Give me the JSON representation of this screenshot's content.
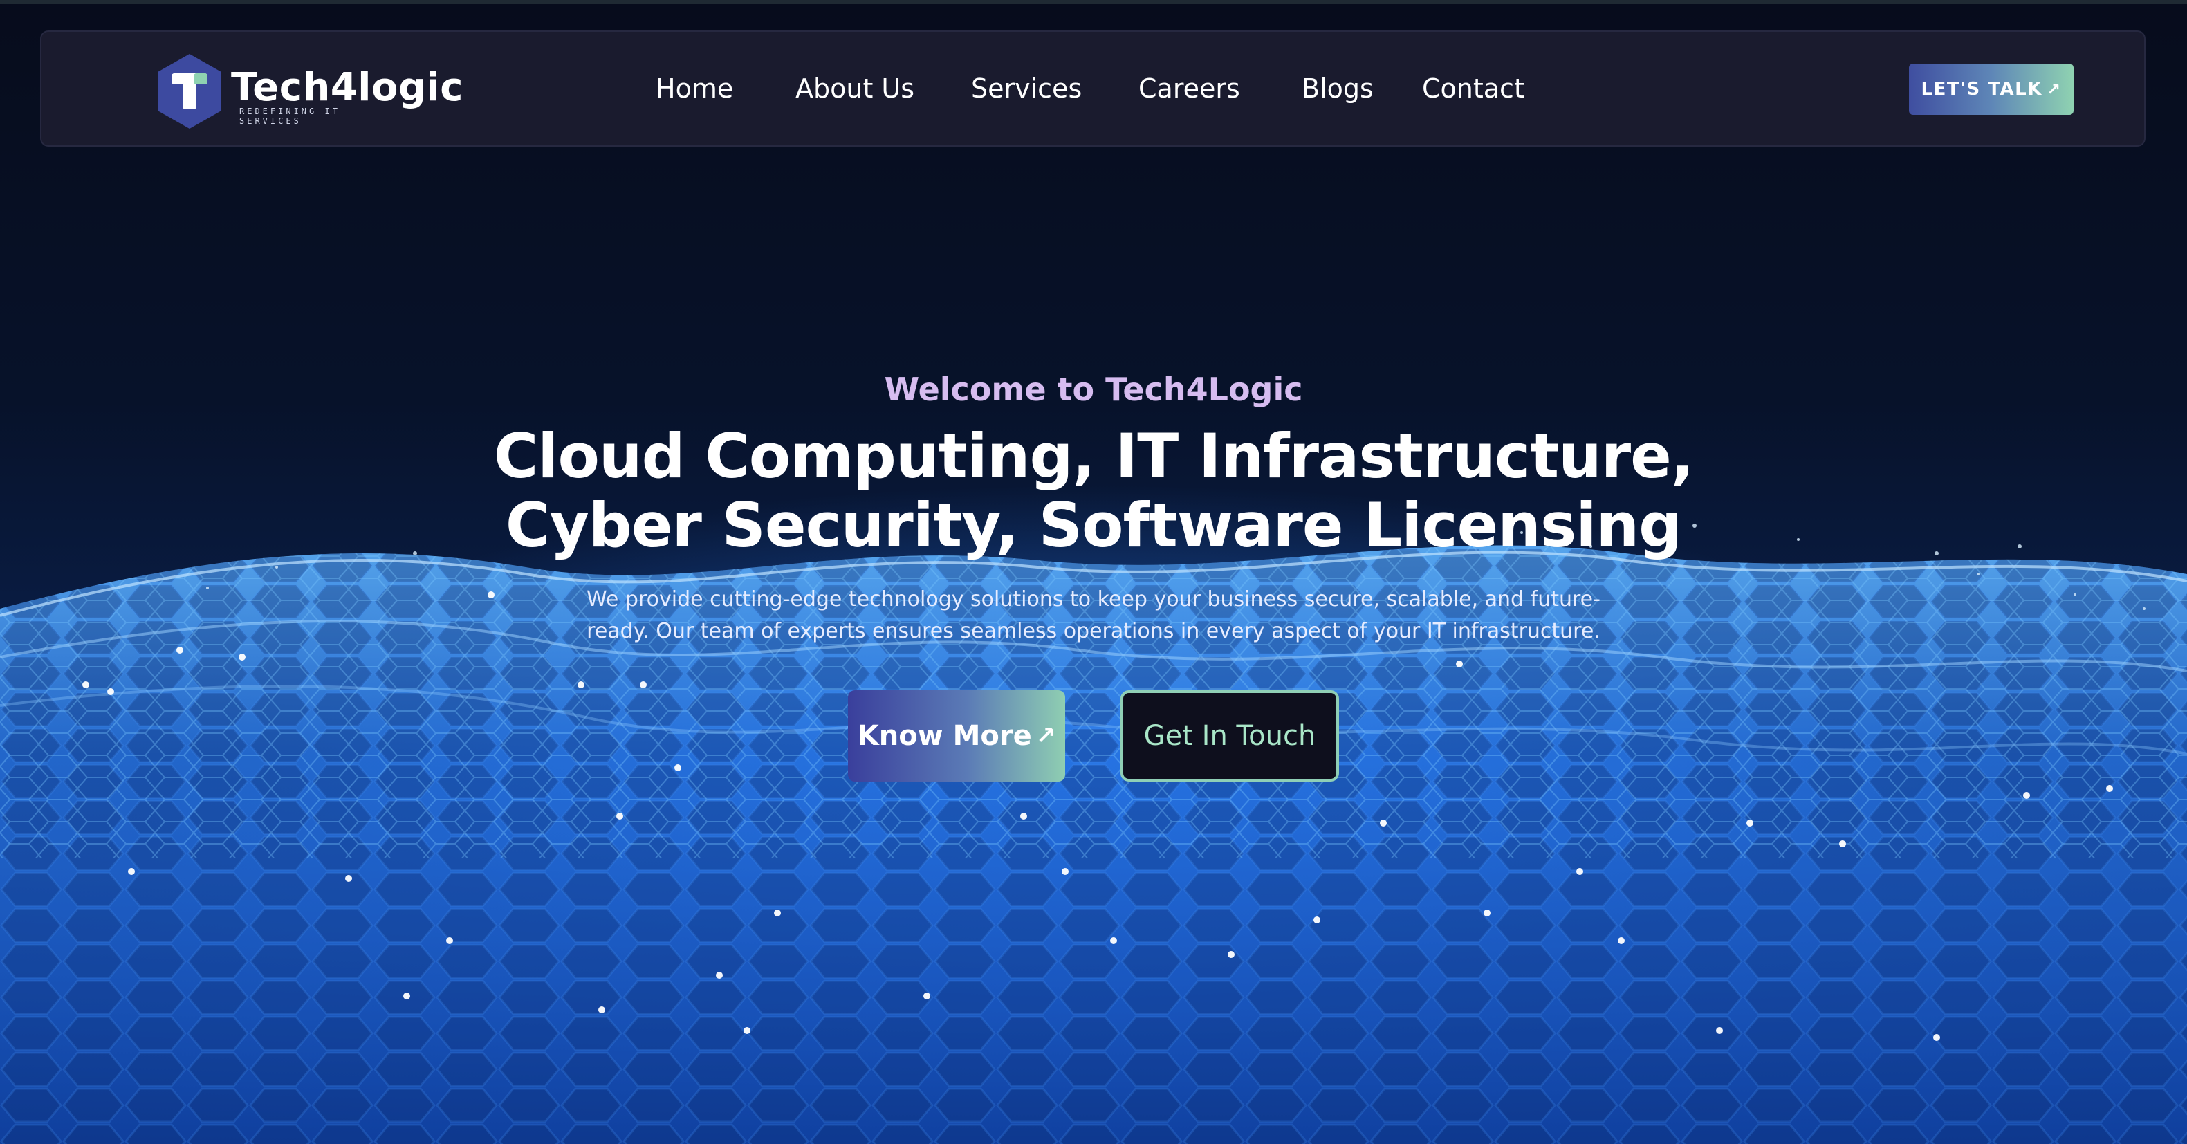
{
  "brand": {
    "name": "Tech4logic",
    "tagline": "REDEFINING IT SERVICES",
    "logo_letter": "T",
    "colors": {
      "hex_primary": "#3d4aa0",
      "hex_accent": "#8fd2b1",
      "nav_bg": "#1a1b2e"
    }
  },
  "nav": {
    "items": [
      {
        "label": "Home"
      },
      {
        "label": "About Us"
      },
      {
        "label": "Services"
      },
      {
        "label": "Careers"
      },
      {
        "label": "Blogs"
      },
      {
        "label": "Contact"
      }
    ],
    "cta_label": "LET'S TALK",
    "cta_icon": "arrow-up-right-icon"
  },
  "hero": {
    "eyebrow": "Welcome to Tech4Logic",
    "title_line1": "Cloud Computing, IT Infrastructure,",
    "title_line2": "Cyber Security, Software Licensing",
    "description_line1": "We provide cutting-edge technology solutions to keep your business secure, scalable, and future-",
    "description_line2": "ready. Our team of experts ensures seamless operations in every aspect of your IT infrastructure.",
    "primary_button": "Know More",
    "primary_button_icon": "arrow-up-right-icon",
    "secondary_button": "Get In Touch",
    "background": "blue-digital-wave-mesh"
  }
}
